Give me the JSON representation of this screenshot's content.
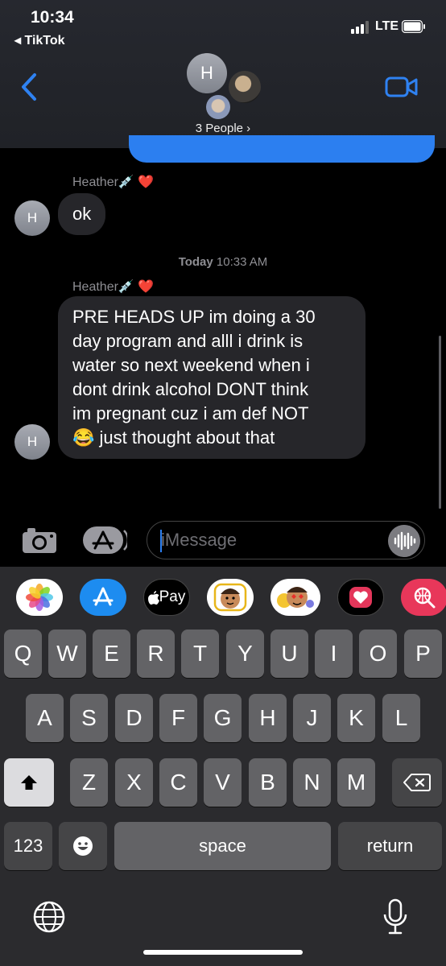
{
  "status_bar": {
    "time": "10:34",
    "back_app": "◂ TikTok",
    "network": "LTE"
  },
  "header": {
    "avatar_initial": "H",
    "people_label": "3 People ›"
  },
  "messages": [
    {
      "sender": "Heather💉 ❤️",
      "text": "ok",
      "avatar": "H"
    },
    {
      "sender": "Heather💉 ❤️",
      "lines": [
        "PRE HEADS UP im doing a 30",
        "day program and alll i drink is",
        "water so next weekend when i",
        "dont drink alcohol DONT think",
        "im pregnant cuz i am def NOT",
        "😂 just thought about that"
      ],
      "avatar": "H"
    }
  ],
  "timestamp": {
    "day": "Today",
    "time": "10:33 AM"
  },
  "compose": {
    "placeholder": "iMessage"
  },
  "app_strip": {
    "applepay_label": "Pay"
  },
  "keyboard": {
    "row1": [
      "Q",
      "W",
      "E",
      "R",
      "T",
      "Y",
      "U",
      "I",
      "O",
      "P"
    ],
    "row2": [
      "A",
      "S",
      "D",
      "F",
      "G",
      "H",
      "J",
      "K",
      "L"
    ],
    "row3": [
      "Z",
      "X",
      "C",
      "V",
      "B",
      "N",
      "M"
    ],
    "numbers_label": "123",
    "space_label": "space",
    "return_label": "return"
  },
  "colors": {
    "accent": "#2c7ff0",
    "bubble": "#26262a",
    "keyboard": "#2b2b2e"
  }
}
